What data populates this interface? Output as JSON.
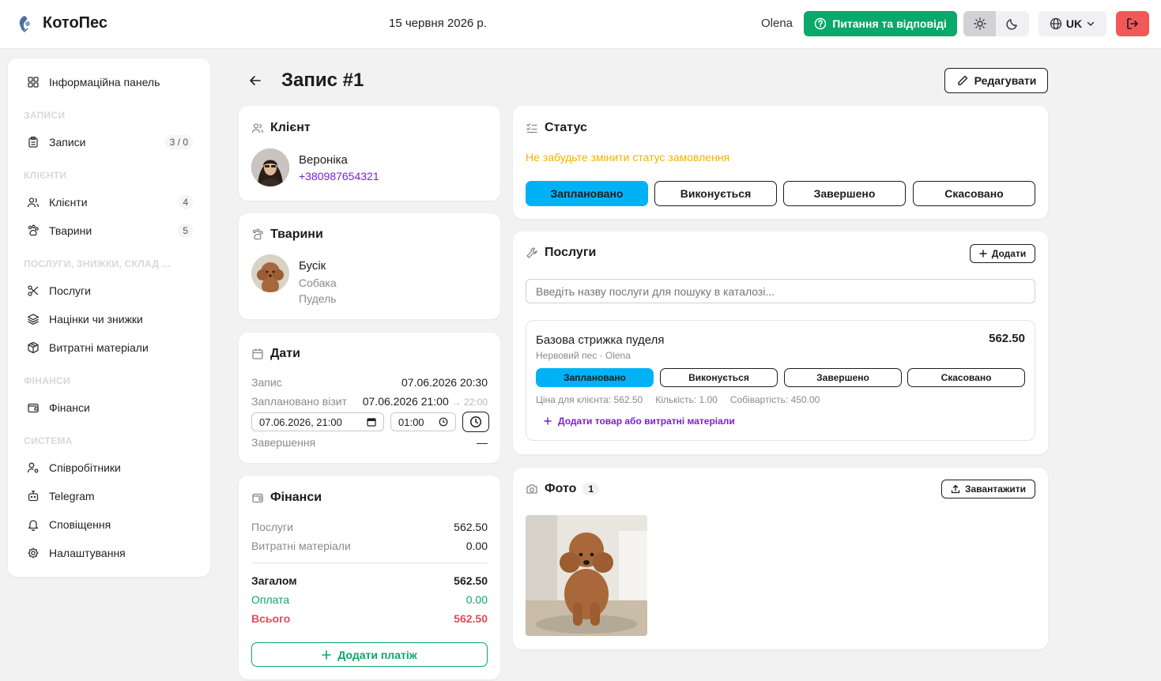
{
  "topbar": {
    "app_name": "КотоПес",
    "date": "15 червня 2026 р.",
    "user": "Olena",
    "help_label": "Питання та відповіді",
    "lang_label": "UK"
  },
  "sidebar": {
    "dashboard": "Інформаційна панель",
    "section_records": "ЗАПИСИ",
    "records": "Записи",
    "records_badge": "3 / 0",
    "section_clients": "КЛІЄНТИ",
    "clients": "Клієнти",
    "clients_badge": "4",
    "pets": "Тварини",
    "pets_badge": "5",
    "section_services": "ПОСЛУГИ, ЗНИЖКИ, СКЛАД ...",
    "services": "Послуги",
    "markups": "Націнки чи знижки",
    "materials": "Витратні матеріали",
    "section_finance": "ФІНАНСИ",
    "finance": "Фінанси",
    "section_system": "СИСТЕМА",
    "employees": "Співробітники",
    "telegram": "Telegram",
    "notifications": "Сповіщення",
    "settings": "Налаштування"
  },
  "page": {
    "title": "Запис #1",
    "edit_label": "Редагувати"
  },
  "client": {
    "title": "Клієнт",
    "name": "Вероніка",
    "phone": "+380987654321"
  },
  "pets": {
    "title": "Тварини",
    "name": "Бусік",
    "species": "Собака",
    "breed": "Пудель"
  },
  "dates": {
    "title": "Дати",
    "record_label": "Запис",
    "record_value": "07.06.2026 20:30",
    "planned_label": "Заплановано візит",
    "planned_value": "07.06.2026 21:00",
    "planned_end": "→ 22:00",
    "date_input": "07.06.2026, 21:00",
    "time_input": "01:00",
    "completion_label": "Завершення",
    "completion_value": "—"
  },
  "finance": {
    "title": "Фінанси",
    "services_label": "Послуги",
    "services_value": "562.50",
    "materials_label": "Витратні матеріали",
    "materials_value": "0.00",
    "total_label": "Загалом",
    "total_value": "562.50",
    "paid_label": "Оплата",
    "paid_value": "0.00",
    "due_label": "Всього",
    "due_value": "562.50",
    "add_payment": "Додати платіж"
  },
  "status": {
    "title": "Статус",
    "warning": "Не забудьте змінити статус замовлення",
    "options": [
      "Заплановано",
      "Виконується",
      "Завершено",
      "Скасовано"
    ],
    "active_index": 0
  },
  "services": {
    "title": "Послуги",
    "add_label": "Додати",
    "search_placeholder": "Введіть назву послуги для пошуку в каталозі...",
    "item": {
      "name": "Базова стрижка пуделя",
      "price": "562.50",
      "meta": "Нервовий пес · Olena",
      "client_price": "Ціна для клієнта: 562.50",
      "quantity": "Кількість: 1.00",
      "cost": "Собівартість: 450.00",
      "add_material": "Додати товар або витратні матеріали"
    }
  },
  "photos": {
    "title": "Фото",
    "count": "1",
    "upload_label": "Завантажити"
  },
  "colors": {
    "accent_green": "#0aa86a",
    "status_active": "#00b2f5",
    "warning": "#f0b400",
    "danger": "#e24b5b",
    "link": "#7a1fd6"
  }
}
